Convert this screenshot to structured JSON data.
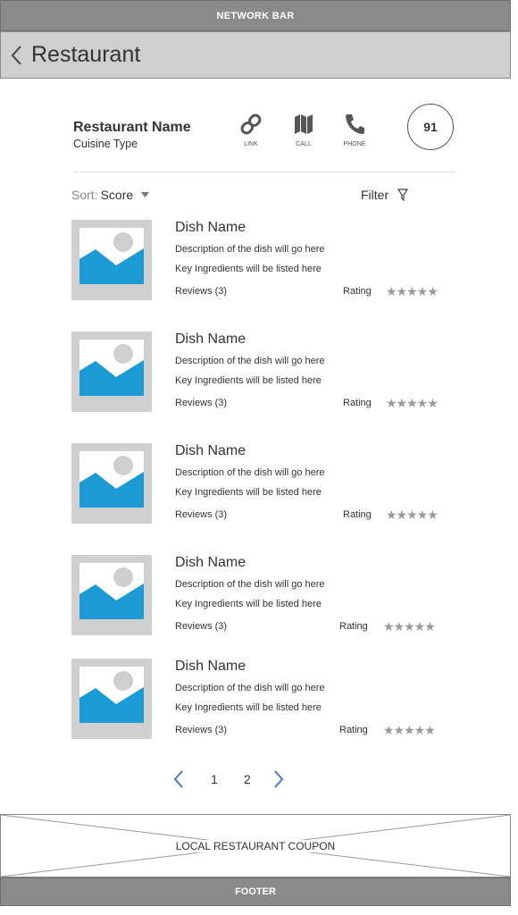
{
  "network_bar": {
    "label": "NETWORK BAR"
  },
  "header": {
    "title": "Restaurant",
    "back_icon": "chevron-left-icon"
  },
  "restaurant": {
    "name": "Restaurant Name",
    "cuisine": "Cuisine Type",
    "score": "91",
    "actions": [
      {
        "label": "LINK",
        "icon": "link-icon"
      },
      {
        "label": "CALL",
        "icon": "map-icon"
      },
      {
        "label": "PHONE",
        "icon": "phone-icon"
      }
    ]
  },
  "sort": {
    "label": "Sort:",
    "value": "Score"
  },
  "filter": {
    "label": "Filter",
    "icon": "filter-icon"
  },
  "dishes": [
    {
      "name": "Dish Name",
      "description": "Description of the dish will go here",
      "ingredients": "Key Ingredients will be listed here",
      "reviews": "Reviews (3)",
      "rating_label": "Rating",
      "rating": 5
    },
    {
      "name": "Dish Name",
      "description": "Description of the dish will go here",
      "ingredients": "Key Ingredients will be listed here",
      "reviews": "Reviews (3)",
      "rating_label": "Rating",
      "rating": 5
    },
    {
      "name": "Dish Name",
      "description": "Description of the dish will go here",
      "ingredients": "Key Ingredients will be listed here",
      "reviews": "Reviews (3)",
      "rating_label": "Rating",
      "rating": 5
    },
    {
      "name": "Dish Name",
      "description": "Description of the dish will go here",
      "ingredients": "Key Ingredients will be listed here",
      "reviews": "Reviews (3)",
      "rating_label": "Rating",
      "rating": 5
    },
    {
      "name": "Dish Name",
      "description": "Description of the dish will go here",
      "ingredients": "Key Ingredients will be listed here",
      "reviews": "Reviews (3)",
      "rating_label": "Rating",
      "rating": 5
    }
  ],
  "pagination": {
    "pages": [
      "1",
      "2"
    ]
  },
  "coupon": {
    "label": "LOCAL RESTAURANT COUPON"
  },
  "footer": {
    "label": "FOOTER"
  },
  "colors": {
    "bars": "#8a8a8a",
    "header": "#cfcfcf",
    "pager_arrows": "#4a78c2",
    "image_sky": "#1b9ad6",
    "stars": "#9a9a9a"
  }
}
